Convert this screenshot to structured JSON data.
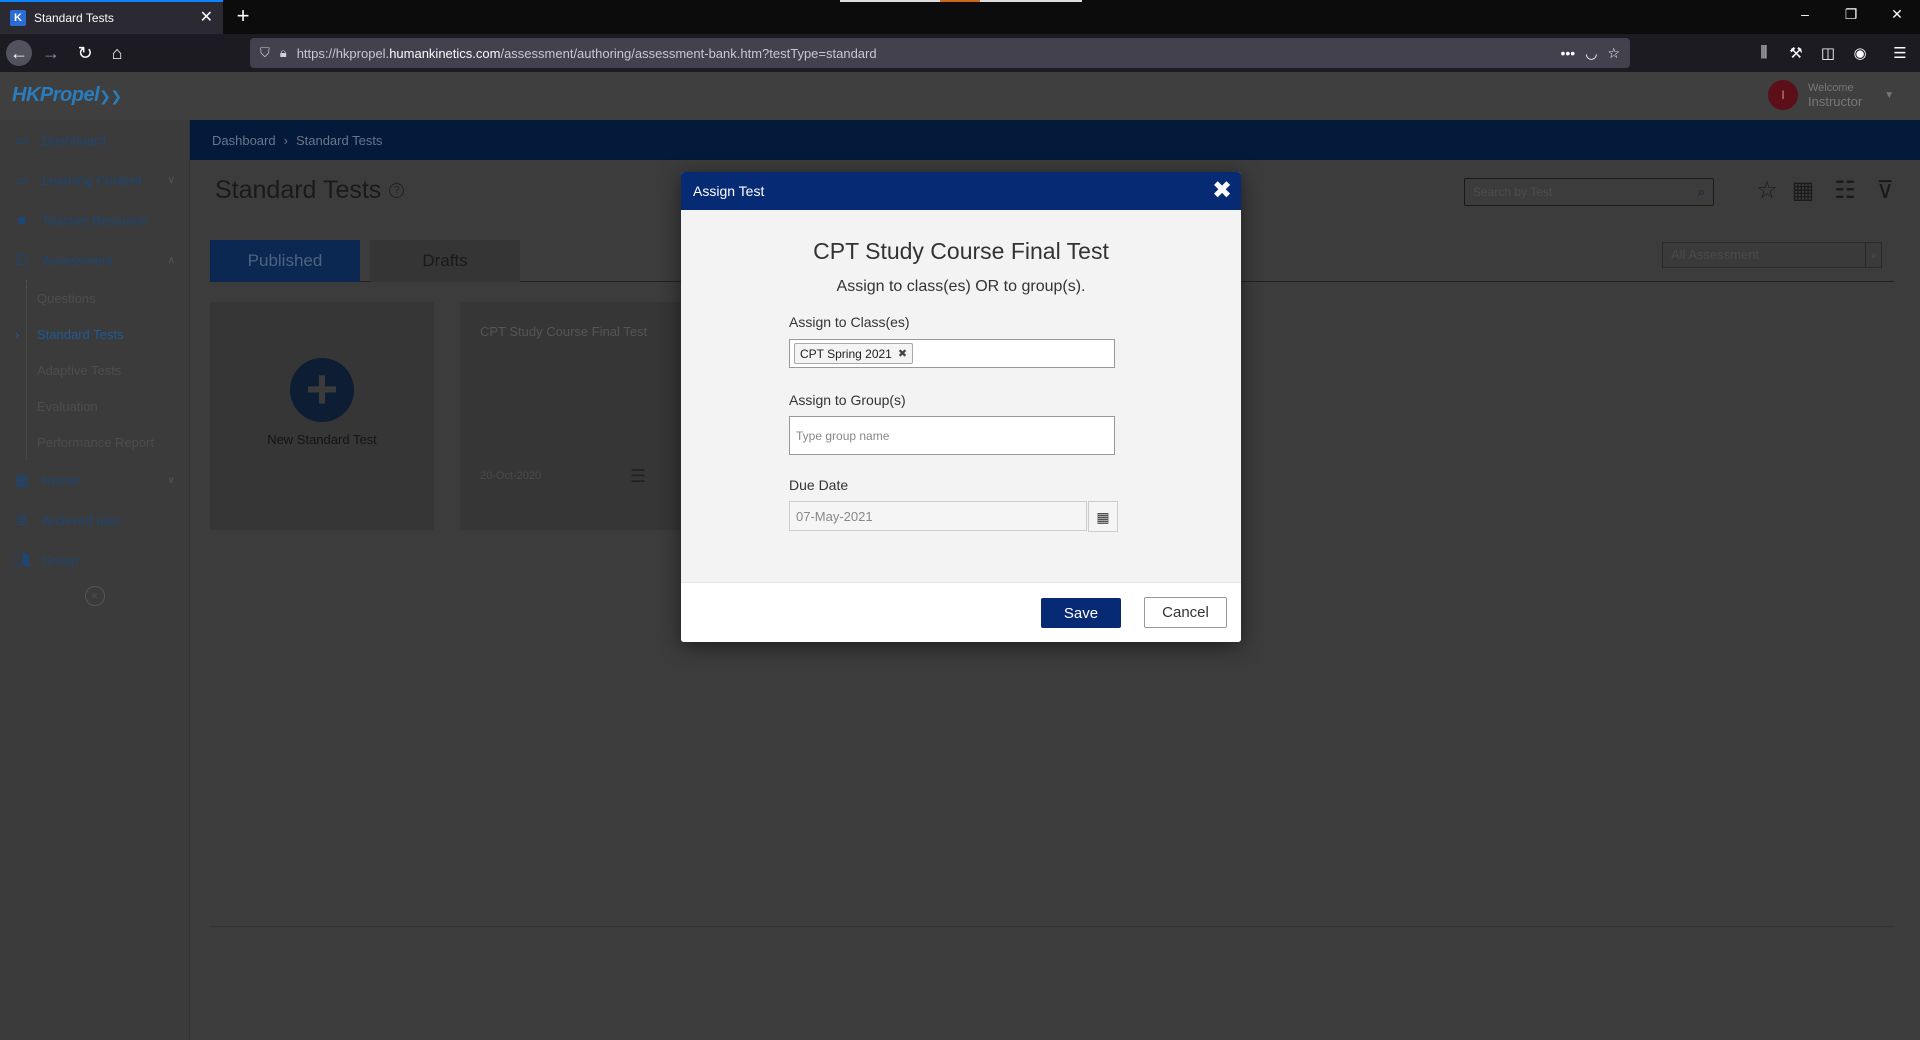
{
  "browser": {
    "tab_title": "Standard Tests",
    "url_prefix": "https://hkpropel.",
    "url_domain": "humankinetics.com",
    "url_path": "/assessment/authoring/assessment-bank.htm?testType=standard"
  },
  "header": {
    "logo_text": "HKPropel",
    "logo_suffix": "❯❯",
    "avatar_initial": "I",
    "welcome": "Welcome",
    "user_name": "Instructor"
  },
  "sidebar": {
    "items": [
      {
        "label": "Dashboard"
      },
      {
        "label": "Learning Content"
      },
      {
        "label": "Teacher Resource"
      },
      {
        "label": "Assessment"
      },
      {
        "label": "Roster"
      },
      {
        "label": "Archived user"
      },
      {
        "label": "Group"
      }
    ],
    "assessment_sub": [
      {
        "label": "Questions"
      },
      {
        "label": "Standard Tests"
      },
      {
        "label": "Adaptive Tests"
      },
      {
        "label": "Evaluation"
      },
      {
        "label": "Performance Report"
      }
    ]
  },
  "breadcrumb": {
    "home": "Dashboard",
    "separator": "›",
    "current": "Standard Tests"
  },
  "main": {
    "title": "Standard Tests",
    "search_placeholder": "Search by Test",
    "tabs": [
      {
        "label": "Published"
      },
      {
        "label": "Drafts"
      }
    ],
    "filter_selected": "All Assessment",
    "new_card_label": "New Standard Test",
    "test_card": {
      "title": "CPT Study Course Final Test",
      "date": "20-Oct-2020"
    }
  },
  "modal": {
    "header": "Assign Test",
    "title": "CPT Study Course Final Test",
    "subtitle": "Assign to class(es) OR to group(s).",
    "class_label": "Assign to Class(es)",
    "class_chip": "CPT Spring 2021",
    "group_label": "Assign to Group(s)",
    "group_placeholder": "Type group name",
    "due_label": "Due Date",
    "due_value": "07-May-2021",
    "save_label": "Save",
    "cancel_label": "Cancel"
  },
  "colors": {
    "brand_navy": "#062a74",
    "link_blue": "#1e4674",
    "browser_accent": "#0a84ff"
  }
}
